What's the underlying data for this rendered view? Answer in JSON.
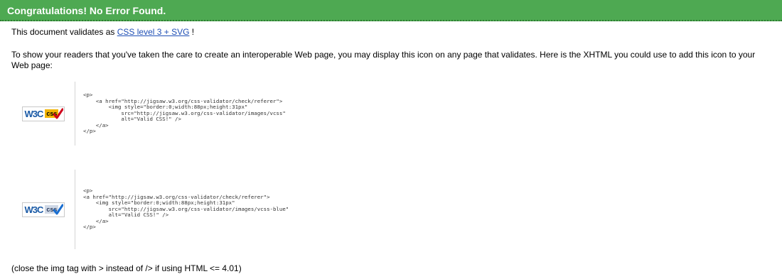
{
  "banner": {
    "title": "Congratulations! No Error Found."
  },
  "validation": {
    "prefix": "This document validates as ",
    "link_text": "CSS level 3 + SVG",
    "suffix": " !"
  },
  "intro_text": "To show your readers that you've taken the care to create an interoperable Web page, you may display this icon on any page that validates. Here is the XHTML you could use to add this icon to your Web page:",
  "icons": [
    {
      "badge_w3c": "W3C",
      "badge_css": "css",
      "badge_style": "gold",
      "code": "<p>\n    <a href=\"http://jigsaw.w3.org/css-validator/check/referer\">\n        <img style=\"border:0;width:88px;height:31px\"\n            src=\"http://jigsaw.w3.org/css-validator/images/vcss\"\n            alt=\"Valid CSS!\" />\n    </a>\n</p>"
    },
    {
      "badge_w3c": "W3C",
      "badge_css": "css",
      "badge_style": "blue",
      "code": "<p>\n<a href=\"http://jigsaw.w3.org/css-validator/check/referer\">\n    <img style=\"border:0;width:88px;height:31px\"\n        src=\"http://jigsaw.w3.org/css-validator/images/vcss-blue\"\n        alt=\"Valid CSS!\" />\n    </a>\n</p>"
    }
  ],
  "note": "(close the img tag with > instead of /> if using HTML <= 4.01)",
  "colors": {
    "banner_bg": "#4ea952",
    "link": "#1f4fb5",
    "check_red": "#d0021b",
    "check_blue": "#1a6fd1",
    "gold": "#f2b400"
  }
}
